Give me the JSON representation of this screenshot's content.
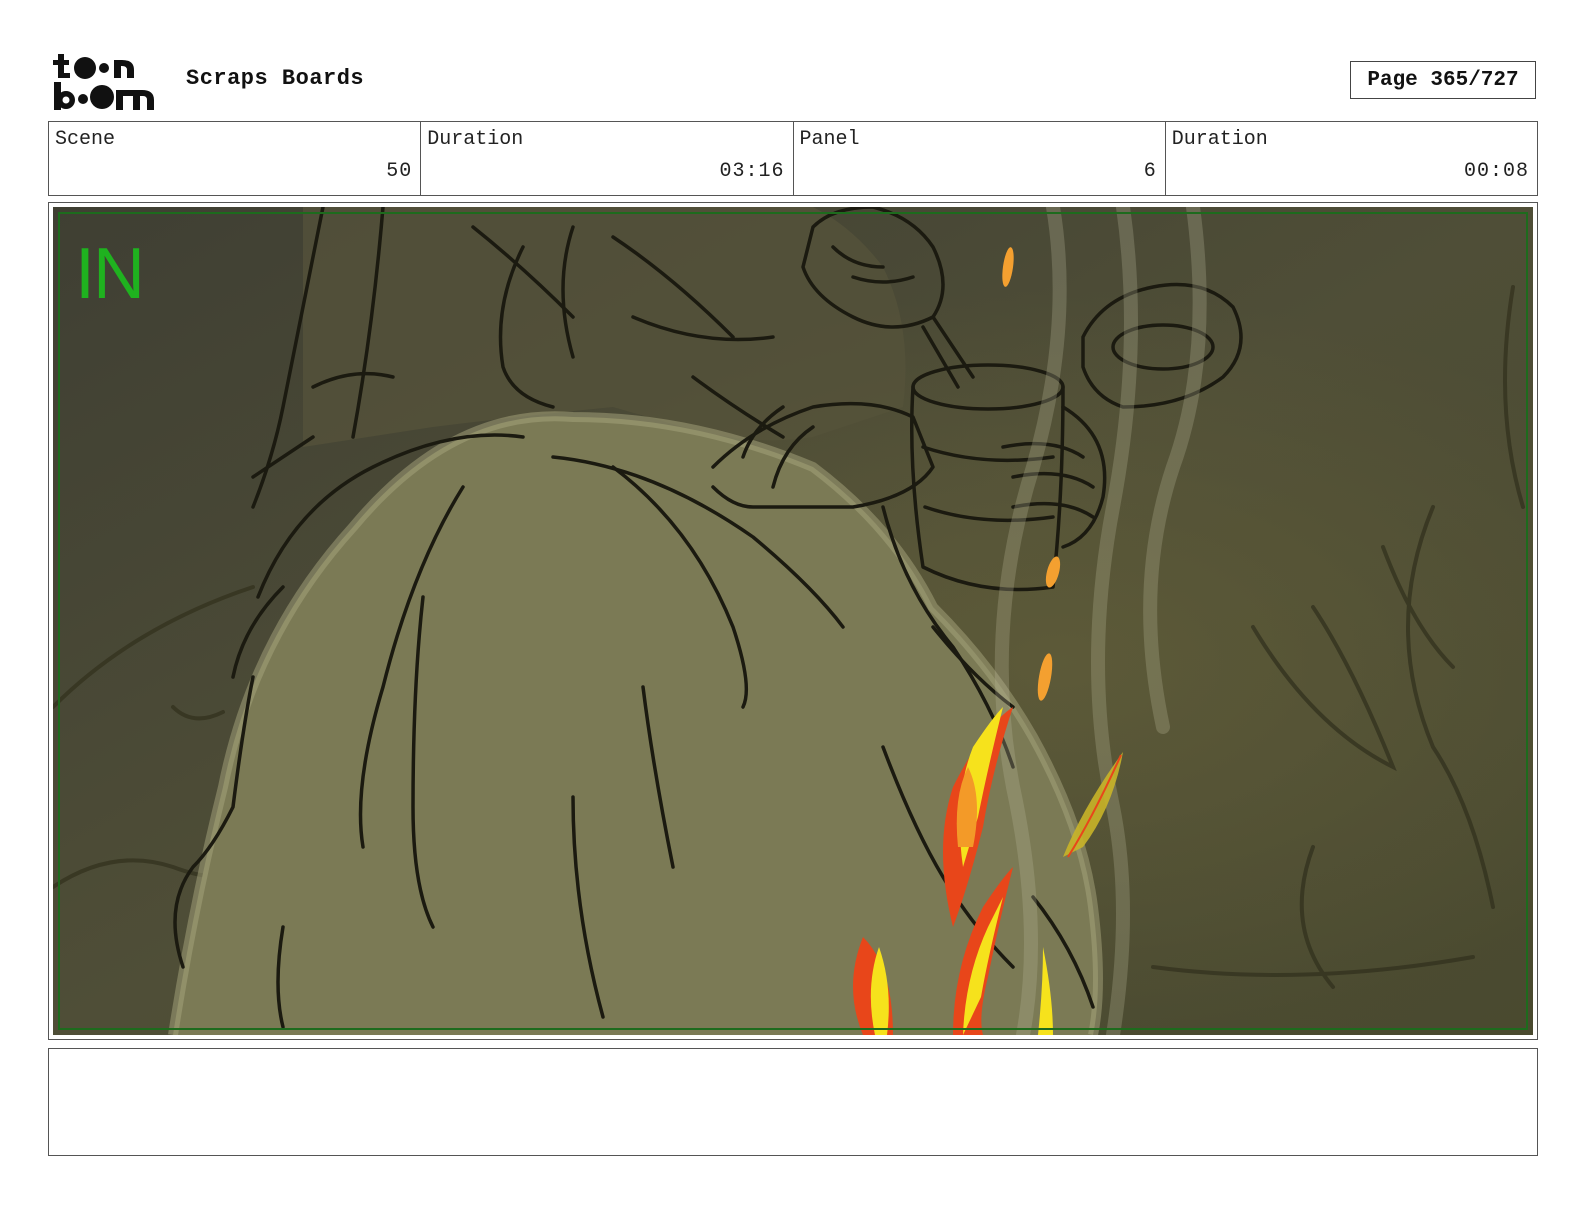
{
  "header": {
    "logo_alt": "toon boom",
    "title": "Scraps Boards",
    "page_label": "Page 365/727"
  },
  "info": {
    "scene_label": "Scene",
    "scene_value": "50",
    "scene_duration_label": "Duration",
    "scene_duration_value": "03:16",
    "panel_label": "Panel",
    "panel_value": "6",
    "panel_duration_label": "Duration",
    "panel_duration_value": "00:08"
  },
  "panel": {
    "overlay_text": "IN"
  },
  "notes": {
    "text": ""
  }
}
